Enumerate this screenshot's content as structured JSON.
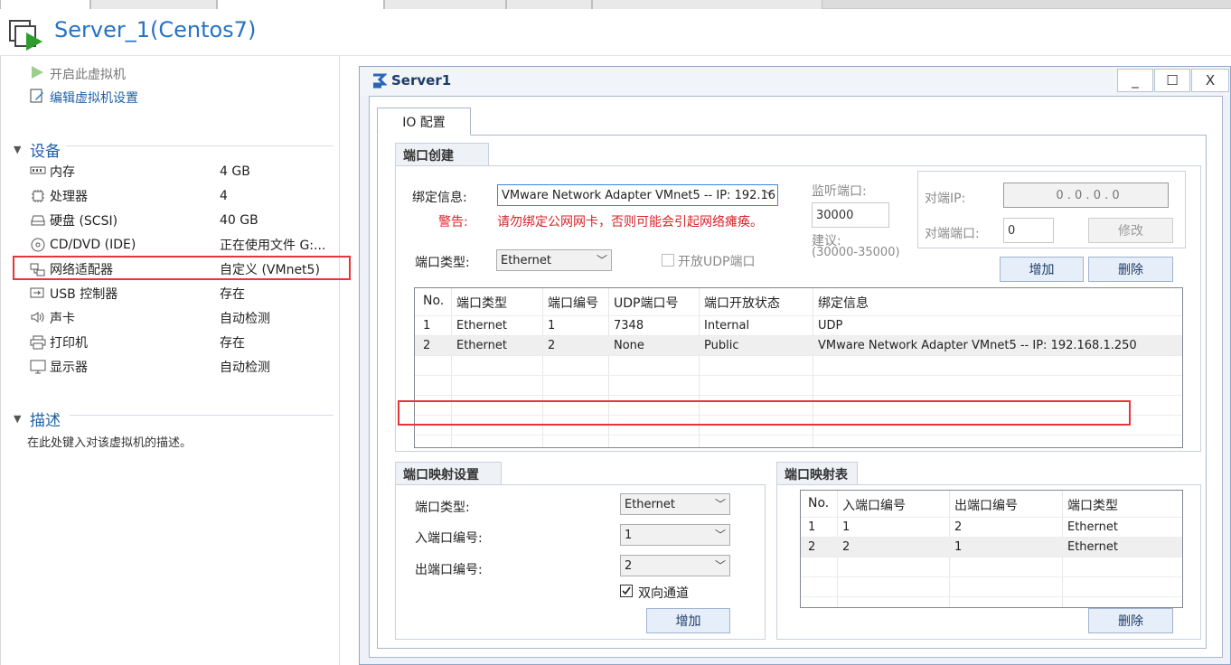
{
  "vm_title": "Server_1(Centos7)",
  "commands": {
    "power_on": "开启此虚拟机",
    "edit_settings": "编辑虚拟机设置"
  },
  "devices_section": {
    "header": "设备",
    "items": [
      {
        "name": "内存",
        "value": "4 GB",
        "icon": "memory-icon"
      },
      {
        "name": "处理器",
        "value": "4",
        "icon": "cpu-icon"
      },
      {
        "name": "硬盘 (SCSI)",
        "value": "40 GB",
        "icon": "hdd-icon"
      },
      {
        "name": "CD/DVD (IDE)",
        "value": "正在使用文件 G:...",
        "icon": "cd-icon"
      },
      {
        "name": "网络适配器",
        "value": "自定义 (VMnet5)",
        "icon": "network-icon"
      },
      {
        "name": "USB 控制器",
        "value": "存在",
        "icon": "usb-icon"
      },
      {
        "name": "声卡",
        "value": "自动检测",
        "icon": "speaker-icon"
      },
      {
        "name": "打印机",
        "value": "存在",
        "icon": "printer-icon"
      },
      {
        "name": "显示器",
        "value": "自动检测",
        "icon": "monitor-icon"
      }
    ]
  },
  "description_section": {
    "header": "描述",
    "text": "在此处键入对该虚拟机的描述。"
  },
  "dialog": {
    "title": "Server1",
    "tab": "IO 配置",
    "port_create": {
      "group_title": "端口创建",
      "bind_label": "绑定信息:",
      "bind_value": "VMware Network Adapter VMnet5 -- IP: 192.16",
      "warning_label": "警告:",
      "warning_text": "请勿绑定公网网卡，否则可能会引起网络瘫痪。",
      "port_type_label": "端口类型:",
      "port_type_value": "Ethernet",
      "open_udp_label": "开放UDP端口",
      "listen_port_label": "监听端口:",
      "listen_port_value": "30000",
      "suggest_label": "建议:",
      "suggest_range": "(30000-35000)",
      "remote_ip_label": "对端IP:",
      "remote_ip_value": "0  .  0  .  0  .  0",
      "remote_port_label": "对端端口:",
      "remote_port_value": "0",
      "modify_button": "修改",
      "add_button": "增加",
      "delete_button": "删除",
      "table": {
        "columns": [
          "No.",
          "端口类型",
          "端口编号",
          "UDP端口号",
          "端口开放状态",
          "绑定信息"
        ],
        "rows": [
          [
            "1",
            "Ethernet",
            "1",
            "7348",
            "Internal",
            "UDP"
          ],
          [
            "2",
            "Ethernet",
            "2",
            "None",
            "Public",
            "VMware Network Adapter VMnet5 -- IP: 192.168.1.250"
          ]
        ]
      }
    },
    "port_mapping_settings": {
      "group_title": "端口映射设置",
      "port_type_label": "端口类型:",
      "port_type_value": "Ethernet",
      "in_port_label": "入端口编号:",
      "in_port_value": "1",
      "out_port_label": "出端口编号:",
      "out_port_value": "2",
      "bidirectional_label": "双向通道",
      "add_button": "增加"
    },
    "port_mapping_table": {
      "group_title": "端口映射表",
      "columns": [
        "No.",
        "入端口编号",
        "出端口编号",
        "端口类型"
      ],
      "rows": [
        [
          "1",
          "1",
          "2",
          "Ethernet"
        ],
        [
          "2",
          "2",
          "1",
          "Ethernet"
        ]
      ],
      "delete_button": "删除"
    },
    "window_buttons": {
      "minimize": "_",
      "maximize": "☐",
      "close": "X"
    }
  },
  "colors": {
    "title_blue": "#2672c4",
    "highlight_red": "#e8353b",
    "warning_red": "#d8232a"
  }
}
